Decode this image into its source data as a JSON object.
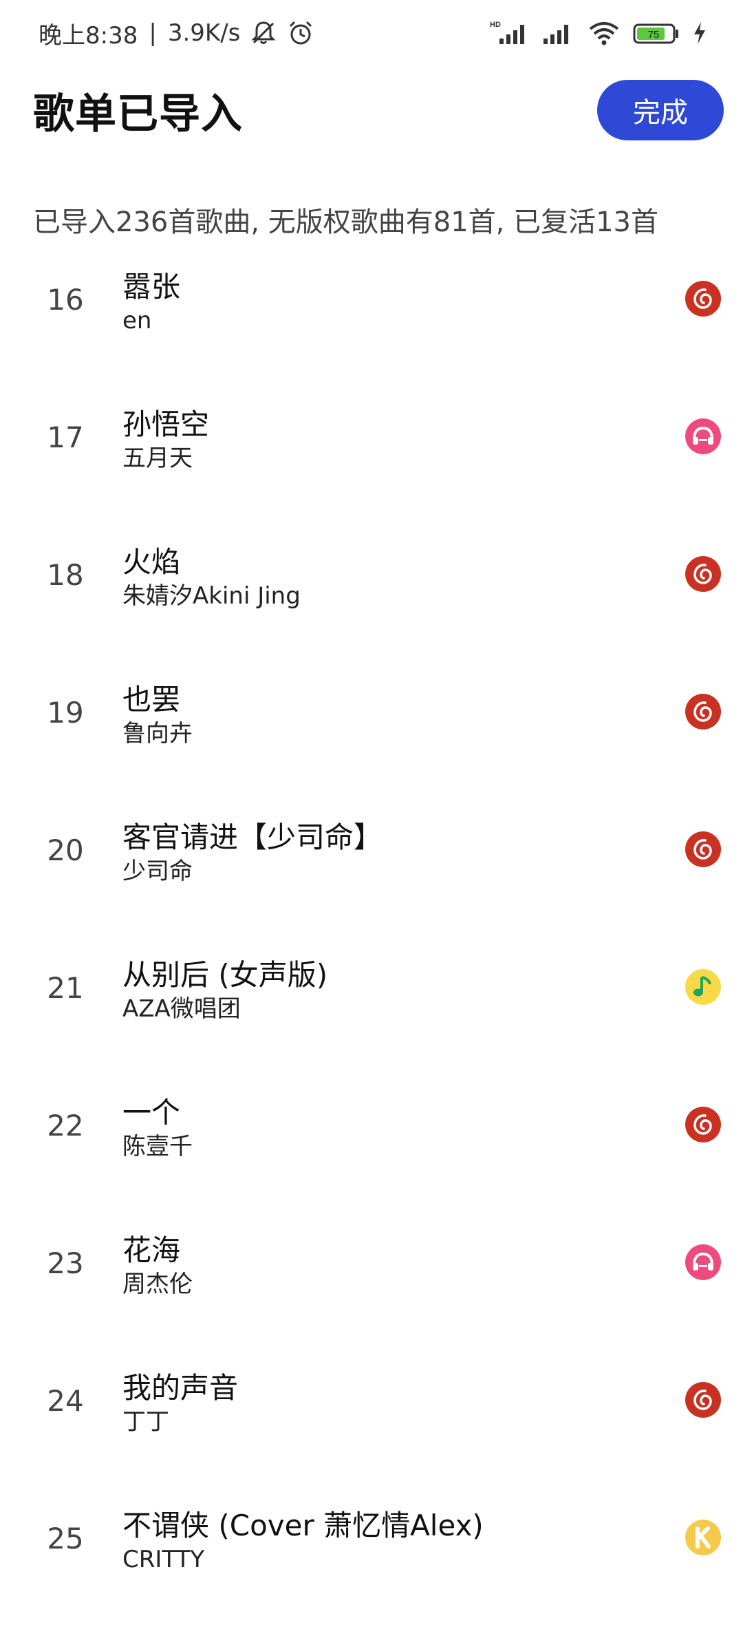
{
  "status_bar": {
    "time": "晚上8:38",
    "separator": "|",
    "net_speed": "3.9K/s",
    "battery_level": "75",
    "icons": [
      "bell-off-icon",
      "alarm-icon",
      "hd-signal-icon",
      "signal-icon",
      "wifi-icon",
      "battery-icon",
      "charging-icon"
    ]
  },
  "header": {
    "title": "歌单已导入",
    "done_label": "完成"
  },
  "summary": "已导入236首歌曲, 无版权歌曲有81首, 已复活13首",
  "colors": {
    "accent": "#2d49d6",
    "netease": "#c93222",
    "kugou_music": "#ee4a7e",
    "qq_music": "#f7d94a",
    "kuwo": "#f6c84c"
  },
  "songs": [
    {
      "index": "16",
      "title": "嚣张",
      "artist": "en",
      "source": "netease-music-icon"
    },
    {
      "index": "17",
      "title": "孙悟空",
      "artist": "五月天",
      "source": "pink-music-icon"
    },
    {
      "index": "18",
      "title": "火焰",
      "artist": "朱婧汐Akini Jing",
      "source": "netease-music-icon"
    },
    {
      "index": "19",
      "title": "也罢",
      "artist": "鲁向卉",
      "source": "netease-music-icon"
    },
    {
      "index": "20",
      "title": "客官请进【少司命】",
      "artist": "少司命",
      "source": "netease-music-icon"
    },
    {
      "index": "21",
      "title": "从别后 (女声版)",
      "artist": "AZA微唱团",
      "source": "qq-music-icon"
    },
    {
      "index": "22",
      "title": "一个",
      "artist": "陈壹千",
      "source": "netease-music-icon"
    },
    {
      "index": "23",
      "title": "花海",
      "artist": "周杰伦",
      "source": "pink-music-icon"
    },
    {
      "index": "24",
      "title": "我的声音",
      "artist": "丁丁",
      "source": "netease-music-icon"
    },
    {
      "index": "25",
      "title": "不谓侠 (Cover 萧忆情Alex)",
      "artist": "CRITTY",
      "source": "kugou-k-icon"
    }
  ]
}
